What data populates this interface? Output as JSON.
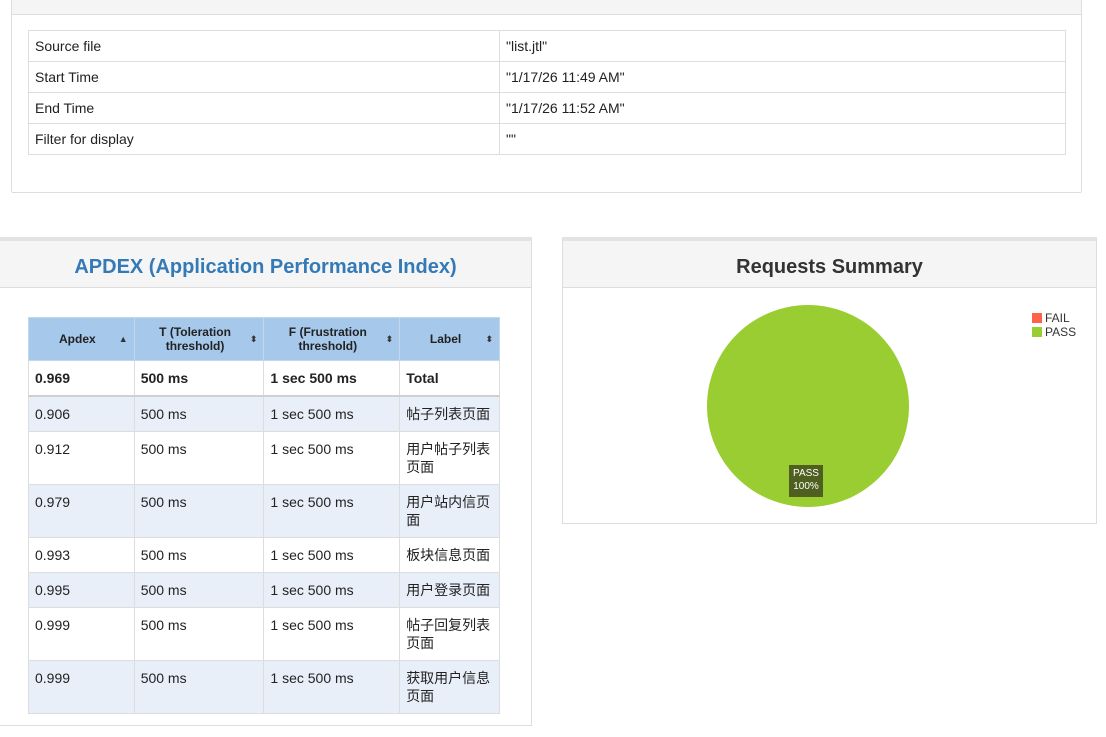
{
  "info": {
    "rows": [
      {
        "key": "Source file",
        "value": "\"list.jtl\""
      },
      {
        "key": "Start Time",
        "value": "\"1/17/26 11:49 AM\""
      },
      {
        "key": "End Time",
        "value": "\"1/17/26 11:52 AM\""
      },
      {
        "key": "Filter for display",
        "value": "\"\""
      }
    ]
  },
  "apdex": {
    "title": "APDEX (Application Performance Index)",
    "headers": {
      "apdex": "Apdex",
      "tol_line1": "T (Toleration",
      "tol_line2": "threshold)",
      "frus_line1": "F (Frustration",
      "frus_line2": "threshold)",
      "label": "Label"
    },
    "total": {
      "apdex": "0.969",
      "t": "500 ms",
      "f": "1 sec 500 ms",
      "label": "Total"
    },
    "rows": [
      {
        "apdex": "0.906",
        "t": "500 ms",
        "f": "1 sec 500 ms",
        "label": "帖子列表页面"
      },
      {
        "apdex": "0.912",
        "t": "500 ms",
        "f": "1 sec 500 ms",
        "label": "用户帖子列表页面"
      },
      {
        "apdex": "0.979",
        "t": "500 ms",
        "f": "1 sec 500 ms",
        "label": "用户站内信页面"
      },
      {
        "apdex": "0.993",
        "t": "500 ms",
        "f": "1 sec 500 ms",
        "label": "板块信息页面"
      },
      {
        "apdex": "0.995",
        "t": "500 ms",
        "f": "1 sec 500 ms",
        "label": "用户登录页面"
      },
      {
        "apdex": "0.999",
        "t": "500 ms",
        "f": "1 sec 500 ms",
        "label": "帖子回复列表页面"
      },
      {
        "apdex": "0.999",
        "t": "500 ms",
        "f": "1 sec 500 ms",
        "label": "获取用户信息页面"
      }
    ],
    "sort_icons": {
      "apdex": "sort-asc-icon",
      "other": "sort-both-icon"
    }
  },
  "requests_summary": {
    "title": "Requests Summary",
    "legend": [
      {
        "name": "FAIL",
        "color": "#ff6347"
      },
      {
        "name": "PASS",
        "color": "#9acd32"
      }
    ],
    "slice_label": {
      "name": "PASS",
      "percent": "100%"
    }
  },
  "chart_data": {
    "type": "pie",
    "title": "Requests Summary",
    "categories": [
      "FAIL",
      "PASS"
    ],
    "values": [
      0,
      100
    ],
    "colors": [
      "#ff6347",
      "#9acd32"
    ],
    "legend_position": "top-right"
  }
}
